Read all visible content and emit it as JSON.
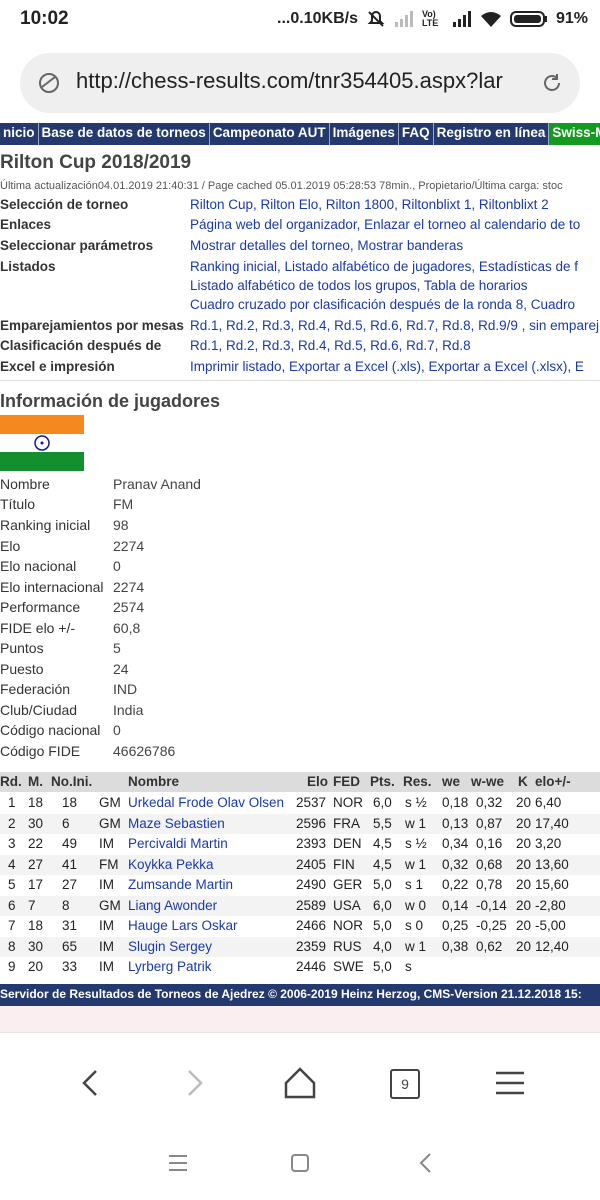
{
  "status": {
    "time": "10:02",
    "network": "...0.10KB/s",
    "lte": "Vo) LTE",
    "battery": "91%"
  },
  "browser": {
    "url": "http://chess-results.com/tnr354405.aspx?lar",
    "tab_count": "9"
  },
  "nav": {
    "items": [
      {
        "label": "Inicio",
        "shown": "nicio"
      },
      {
        "label": "Base de datos de torneos"
      },
      {
        "label": "Campeonato AUT"
      },
      {
        "label": "Imágenes"
      },
      {
        "label": "FAQ"
      },
      {
        "label": "Registro en línea"
      },
      {
        "label": "Swiss-Ma",
        "accent": "#129b1f"
      }
    ]
  },
  "tournament": {
    "title": "Rilton Cup 2018/2019",
    "updated": "Última actualización04.01.2019 21:40:31 / Page cached 05.01.2019 05:28:53 78min., Propietario/Última carga: stoc",
    "rows": [
      {
        "label": "Selección de torneo",
        "value": "Rilton Cup, Rilton Elo, Rilton 1800, Riltonblixt 1, Riltonblixt 2"
      },
      {
        "label": "Enlaces",
        "value": "Página web del organizador, Enlazar el torneo al calendario de to"
      },
      {
        "label": "Seleccionar parámetros",
        "value": "Mostrar detalles del torneo, Mostrar banderas"
      },
      {
        "label": "Listados",
        "value": "Ranking inicial, Listado alfabético de jugadores, Estadísticas de f"
      },
      {
        "label": "",
        "value": "Listado alfabético de todos los grupos, Tabla de horarios"
      },
      {
        "label": "",
        "value": "Cuadro cruzado por clasificación después de la ronda 8, Cuadro"
      },
      {
        "label": "Emparejamientos por mesas",
        "value": "Rd.1, Rd.2, Rd.3, Rd.4, Rd.5, Rd.6, Rd.7, Rd.8, Rd.9/9 , sin emparej"
      },
      {
        "label": "Clasificación después de",
        "value": "Rd.1, Rd.2, Rd.3, Rd.4, Rd.5, Rd.6, Rd.7, Rd.8"
      },
      {
        "label": "Excel e impresión",
        "value": "Imprimir listado, Exportar a Excel (.xls), Exportar a Excel (.xlsx), E"
      }
    ]
  },
  "player": {
    "section_title": "Información de jugadores",
    "flag": "IND",
    "fields": [
      {
        "k": "Nombre",
        "v": "Pranav Anand"
      },
      {
        "k": "Título",
        "v": "FM"
      },
      {
        "k": "Ranking inicial",
        "v": "98"
      },
      {
        "k": "Elo",
        "v": "2274"
      },
      {
        "k": "Elo nacional",
        "v": "0"
      },
      {
        "k": "Elo internacional",
        "v": "2274"
      },
      {
        "k": "Performance",
        "v": "2574"
      },
      {
        "k": "FIDE elo +/-",
        "v": "60,8"
      },
      {
        "k": "Puntos",
        "v": "5"
      },
      {
        "k": "Puesto",
        "v": "24"
      },
      {
        "k": "Federación",
        "v": "IND"
      },
      {
        "k": "Club/Ciudad",
        "v": "India"
      },
      {
        "k": "Código nacional",
        "v": "0"
      },
      {
        "k": "Código FIDE",
        "v": "46626786"
      }
    ]
  },
  "games": {
    "headers": [
      "Rd.",
      "M.",
      "No.Ini.",
      "",
      "Nombre",
      "Elo",
      "FED",
      "Pts.",
      "Res.",
      "we",
      "w-we",
      "K",
      "elo+/-"
    ],
    "rows": [
      [
        "1",
        "18",
        "18",
        "GM",
        "Urkedal Frode Olav Olsen",
        "2537",
        "NOR",
        "6,0",
        "s ½",
        "0,18",
        "0,32",
        "20",
        "6,40"
      ],
      [
        "2",
        "30",
        "6",
        "GM",
        "Maze Sebastien",
        "2596",
        "FRA",
        "5,5",
        "w 1",
        "0,13",
        "0,87",
        "20",
        "17,40"
      ],
      [
        "3",
        "22",
        "49",
        "IM",
        "Percivaldi Martin",
        "2393",
        "DEN",
        "4,5",
        "s ½",
        "0,34",
        "0,16",
        "20",
        "3,20"
      ],
      [
        "4",
        "27",
        "41",
        "FM",
        "Koykka Pekka",
        "2405",
        "FIN",
        "4,5",
        "w 1",
        "0,32",
        "0,68",
        "20",
        "13,60"
      ],
      [
        "5",
        "17",
        "27",
        "IM",
        "Zumsande Martin",
        "2490",
        "GER",
        "5,0",
        "s 1",
        "0,22",
        "0,78",
        "20",
        "15,60"
      ],
      [
        "6",
        "7",
        "8",
        "GM",
        "Liang Awonder",
        "2589",
        "USA",
        "6,0",
        "w 0",
        "0,14",
        "-0,14",
        "20",
        "-2,80"
      ],
      [
        "7",
        "18",
        "31",
        "IM",
        "Hauge Lars Oskar",
        "2466",
        "NOR",
        "5,0",
        "s 0",
        "0,25",
        "-0,25",
        "20",
        "-5,00"
      ],
      [
        "8",
        "30",
        "65",
        "IM",
        "Slugin Sergey",
        "2359",
        "RUS",
        "4,0",
        "w 1",
        "0,38",
        "0,62",
        "20",
        "12,40"
      ],
      [
        "9",
        "20",
        "33",
        "IM",
        "Lyrberg Patrik",
        "2446",
        "SWE",
        "5,0",
        "s",
        "",
        "",
        "",
        ""
      ]
    ]
  },
  "footer": {
    "text": "Servidor de Resultados de Torneos de Ajedrez © 2006-2019 Heinz Herzog, CMS-Version 21.12.2018 15:"
  },
  "colors": {
    "nav_bg": "#243a6e",
    "link": "#1a3aa8",
    "accent_green": "#129b1f"
  }
}
